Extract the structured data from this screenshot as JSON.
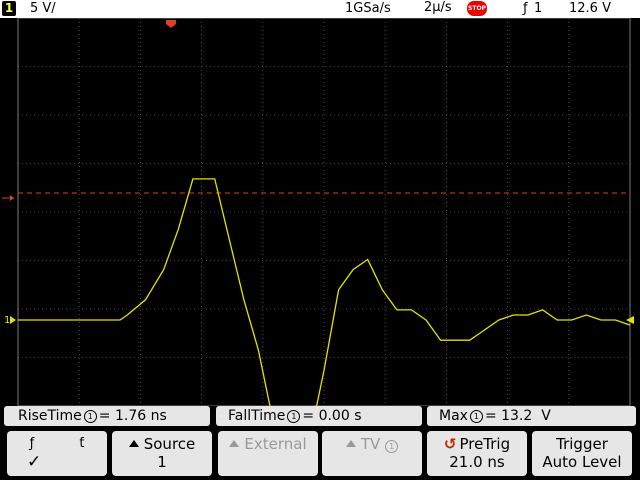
{
  "status": {
    "channel": "1",
    "scale": "5 V/",
    "sample_rate": "1GSa/s",
    "timebase": "2µ/s",
    "run_state": "STOP",
    "trigger_edge_icon": "rising-edge-icon",
    "trigger_source": "1",
    "trigger_level": "12.6  V"
  },
  "colors": {
    "trace": "#e6e200",
    "grid": "#7a7a7a",
    "trigger_line": "#e04020",
    "marker": "#e04020"
  },
  "waveform": {
    "description": "trace shape in volts vs time index",
    "points": [
      [
        0,
        0
      ],
      [
        28,
        0
      ],
      [
        30,
        0.5
      ],
      [
        35,
        2
      ],
      [
        40,
        5
      ],
      [
        44,
        9
      ],
      [
        48,
        14
      ],
      [
        50,
        14
      ],
      [
        54,
        14
      ],
      [
        58,
        8
      ],
      [
        62,
        2
      ],
      [
        66,
        -3
      ],
      [
        70,
        -10
      ],
      [
        74,
        -9.5
      ],
      [
        78,
        -9
      ],
      [
        82,
        -8.5
      ],
      [
        84,
        -5
      ],
      [
        88,
        3
      ],
      [
        92,
        5
      ],
      [
        96,
        6
      ],
      [
        100,
        3
      ],
      [
        104,
        1
      ],
      [
        108,
        1
      ],
      [
        112,
        0
      ],
      [
        116,
        -2
      ],
      [
        120,
        -2
      ],
      [
        124,
        -2
      ],
      [
        128,
        -1
      ],
      [
        132,
        0
      ],
      [
        136,
        0.5
      ],
      [
        140,
        0.5
      ],
      [
        144,
        1
      ],
      [
        148,
        0
      ],
      [
        152,
        0
      ],
      [
        156,
        0.5
      ],
      [
        160,
        0
      ],
      [
        164,
        0
      ],
      [
        168,
        -0.5
      ]
    ]
  },
  "measurements": {
    "rise_label": "RiseTime",
    "rise_value": "= 1.76 ns",
    "fall_label": "FallTime",
    "fall_value": "= 0.00 s",
    "max_label": "Max",
    "max_value": "= 13.2  V",
    "source_glyph": "1"
  },
  "softkeys": {
    "slope_icon_rise": "ƒ",
    "slope_icon_fall": "ƭ",
    "slope_check": "✓",
    "source_label": "Source",
    "source_value": "1",
    "external_label": "External",
    "tv_label": "TV",
    "pretrig_label": "PreTrig",
    "pretrig_value": "21.0 ns",
    "trigger_label": "Trigger",
    "trigger_value": "Auto Level"
  }
}
